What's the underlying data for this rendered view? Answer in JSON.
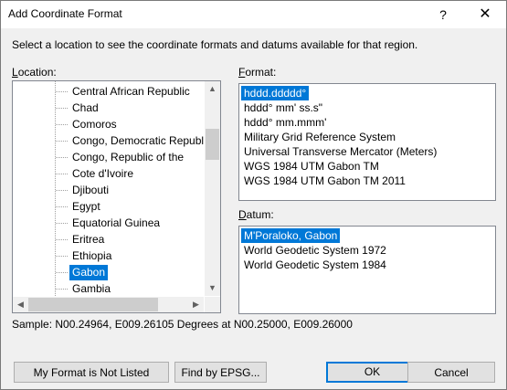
{
  "window": {
    "title": "Add Coordinate Format",
    "help_glyph": "?",
    "close_glyph": "✕"
  },
  "instruction": "Select a location to see the coordinate formats and datums available for that region.",
  "location": {
    "label_underlined": "L",
    "label_rest": "ocation:",
    "items": [
      "Central African Republic",
      "Chad",
      "Comoros",
      "Congo, Democratic Republi",
      "Congo, Republic of the",
      "Cote d'Ivoire",
      "Djibouti",
      "Egypt",
      "Equatorial Guinea",
      "Eritrea",
      "Ethiopia",
      "Gabon",
      "Gambia"
    ],
    "selected": "Gabon",
    "icons": {
      "up": "up-arrow-icon",
      "down": "down-arrow-icon",
      "left": "left-arrow-icon",
      "right": "right-arrow-icon"
    }
  },
  "format": {
    "label_underlined": "F",
    "label_rest": "ormat:",
    "items": [
      "hddd.ddddd°",
      "hddd° mm' ss.s\"",
      "hddd° mm.mmm'",
      "Military Grid Reference System",
      "Universal Transverse Mercator (Meters)",
      "WGS 1984 UTM Gabon TM",
      "WGS 1984 UTM Gabon TM 2011"
    ],
    "selected": "hddd.ddddd°"
  },
  "datum": {
    "label_underlined": "D",
    "label_rest": "atum:",
    "items": [
      "M'Poraloko, Gabon",
      "World Geodetic System 1972",
      "World Geodetic System 1984"
    ],
    "selected": "M'Poraloko, Gabon"
  },
  "sample": "Sample: N00.24964, E009.26105 Degrees at N00.25000, E009.26000",
  "buttons": {
    "not_listed": "My Format is Not Listed",
    "find_epsg": "Find by EPSG...",
    "ok": "OK",
    "cancel": "Cancel"
  },
  "colors": {
    "selection": "#0078d7",
    "focus_border": "#0078d7"
  }
}
